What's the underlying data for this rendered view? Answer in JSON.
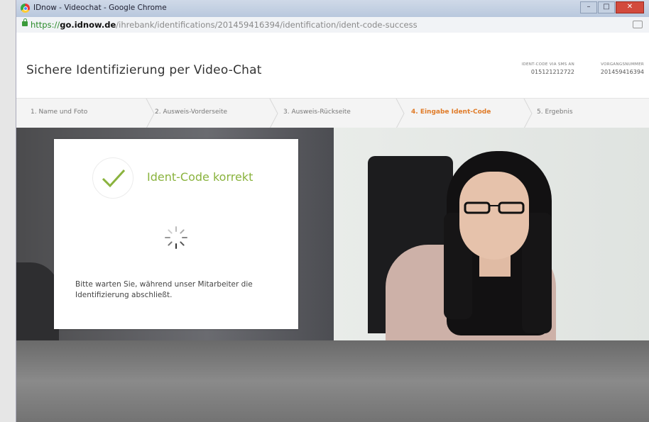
{
  "window": {
    "title": "IDnow - Videochat - Google Chrome"
  },
  "address": {
    "scheme": "https://",
    "host": "go.idnow.de",
    "path": "/ihrebank/identifications/201459416394/identification/ident-code-success"
  },
  "header": {
    "title": "Sichere Identifizierung per Video-Chat",
    "ident_label": "IDENT-CODE VIA SMS AN",
    "ident_value": "015121212722",
    "vorgang_label": "VORGANGSNUMMER",
    "vorgang_value": "201459416394"
  },
  "steps": [
    {
      "label": "1. Name und Foto"
    },
    {
      "label": "2. Ausweis-Vorderseite"
    },
    {
      "label": "3. Ausweis-Rückseite"
    },
    {
      "label": "4. Eingabe Ident-Code"
    },
    {
      "label": "5. Ergebnis"
    }
  ],
  "active_step": 4,
  "card": {
    "title": "Ident-Code korrekt",
    "message": "Bitte warten Sie, während unser Mitarbeiter die Identifizierung abschließt."
  },
  "colors": {
    "accent_orange": "#e07b28",
    "success_green": "#8ab33e"
  },
  "icons": {
    "check": "check-icon",
    "spinner": "loading-spinner-icon",
    "lock": "lock-icon"
  }
}
